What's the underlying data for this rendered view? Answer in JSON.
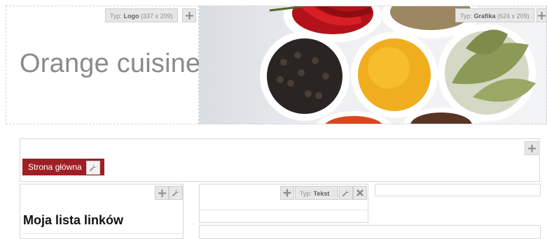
{
  "logo": {
    "text": "Orange cuisine",
    "type_prefix": "Typ: ",
    "type_name": "Logo",
    "type_size": " (337 x 209)"
  },
  "image": {
    "type_prefix": "Typ: ",
    "type_name": "Grafika",
    "type_size": " (624 x 209)"
  },
  "nav": {
    "home_label": "Strona główna"
  },
  "sidebar": {
    "title": "Moja lista linków"
  },
  "text_module": {
    "type_prefix": "Typ: ",
    "type_name": "Tekst"
  },
  "icons": [
    "plus-icon",
    "wrench-icon",
    "move-icon",
    "close-icon"
  ],
  "colors": {
    "nav_accent": "#9e1f24",
    "logo_text": "#8a8a8a"
  }
}
